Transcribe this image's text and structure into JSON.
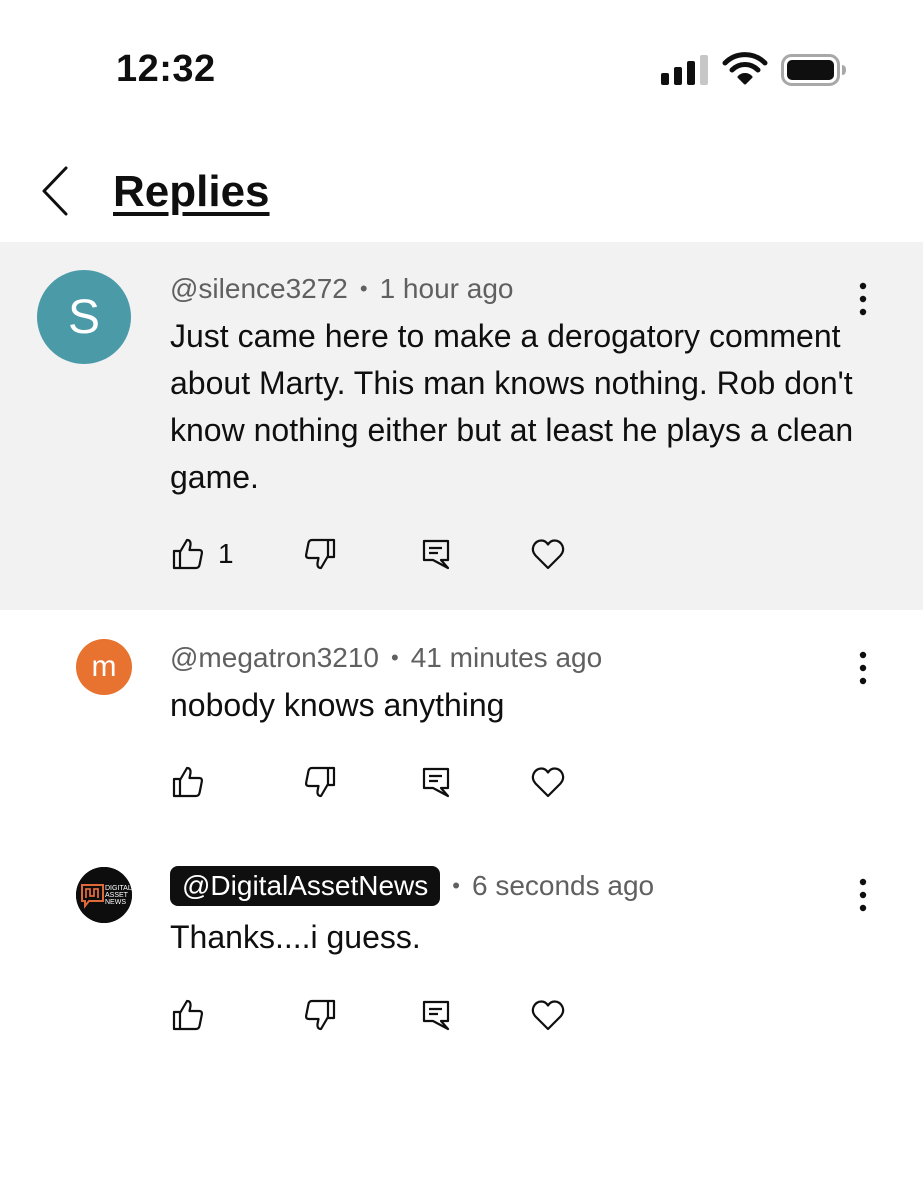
{
  "status_bar": {
    "time": "12:32"
  },
  "header": {
    "title": "Replies"
  },
  "comments": [
    {
      "avatar_letter": "S",
      "avatar_color": "#4a9aa8",
      "handle": "@silence3272",
      "time": "1 hour ago",
      "text": "Just came here to make a derogatory comment about Marty. This man knows nothing. Rob don't know nothing either but at least he plays a clean game.",
      "like_count": "1"
    },
    {
      "avatar_letter": "m",
      "avatar_color": "#e8722f",
      "handle": "@megatron3210",
      "time": "41 minutes ago",
      "text": "nobody knows anything"
    },
    {
      "avatar_logo_text": [
        "DIGITAL",
        "ASSET",
        "NEWS"
      ],
      "handle": "@DigitalAssetNews",
      "time": "6 seconds ago",
      "text": "Thanks....i guess."
    }
  ],
  "separator": "•",
  "icons": [
    "chevron-left-icon",
    "signal-icon",
    "wifi-icon",
    "battery-icon",
    "more-vert-icon",
    "thumb-up-icon",
    "thumb-down-icon",
    "reply-icon",
    "heart-icon"
  ]
}
